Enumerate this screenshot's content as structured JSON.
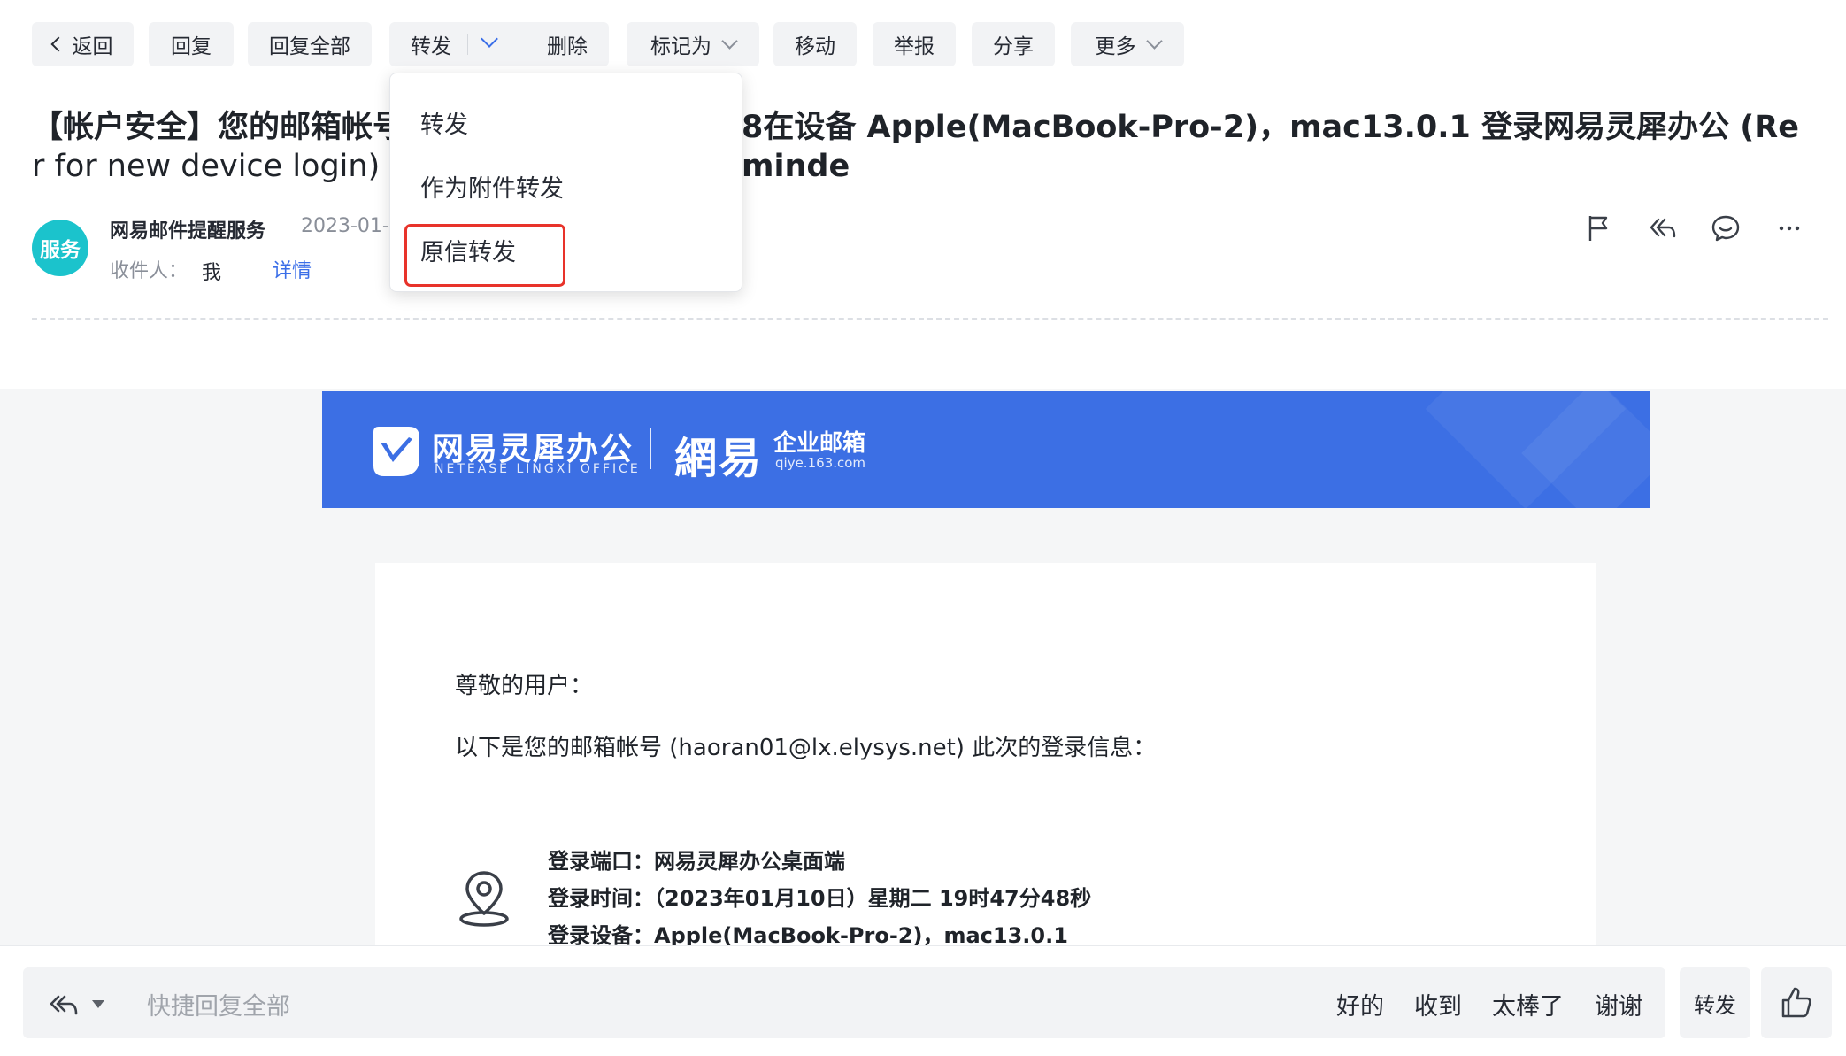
{
  "toolbar": {
    "back": "返回",
    "reply": "回复",
    "reply_all": "回复全部",
    "forward": "转发",
    "delete": "删除",
    "mark_as": "标记为",
    "move": "移动",
    "report": "举报",
    "share": "分享",
    "more": "更多"
  },
  "forward_menu": {
    "items": [
      "转发",
      "作为附件转发",
      "原信转发"
    ],
    "highlighted": "原信转发",
    "highlight_color": "#e8332a"
  },
  "mail": {
    "subject": "【帐户安全】您的邮箱帐号 haoran01@lx.elysys.net 于 2023-01-10 19:47:48在设备 Apple(MacBook-Pro-2)，mac13.0.1 登录网易灵犀办公 (Reminder for new device login)",
    "subject_visible_left": "【帐户安全】您的邮箱帐号",
    "subject_visible_right": "8在设备 Apple(MacBook-Pro-2)，mac13.0.1 登录网易灵犀办公 (Reminde",
    "subject_line2": "r for new device login)",
    "sender_avatar_text": "服务",
    "sender_name": "网易邮件提醒服务",
    "date": "2023-01-",
    "recipients_label": "收件人：",
    "recipient": "我",
    "details_link": "详情",
    "action_icons": [
      "flag-icon",
      "reply-all-icon",
      "comment-icon",
      "more-icon"
    ]
  },
  "banner": {
    "brand_cn": "网易灵犀办公",
    "brand_en": "NETEASE LINGXI OFFICE",
    "brand2": "網易",
    "brand2_sub": "企业邮箱",
    "brand2_url": "qiye.163.com",
    "color": "#3c6fe4"
  },
  "content": {
    "greeting": "尊敬的用户：",
    "intro": "以下是您的邮箱帐号 (haoran01@lx.elysys.net) 此次的登录信息：",
    "login_port": "登录端口：网易灵犀办公桌面端",
    "login_time": "登录时间：（2023年01月10日）星期二 19时47分48秒",
    "login_device": "登录设备：Apple(MacBook-Pro-2)，mac13.0.1"
  },
  "quick_reply": {
    "placeholder": "快捷回复全部",
    "chips": [
      "好的",
      "收到",
      "太棒了",
      "谢谢"
    ],
    "forward": "转发"
  }
}
